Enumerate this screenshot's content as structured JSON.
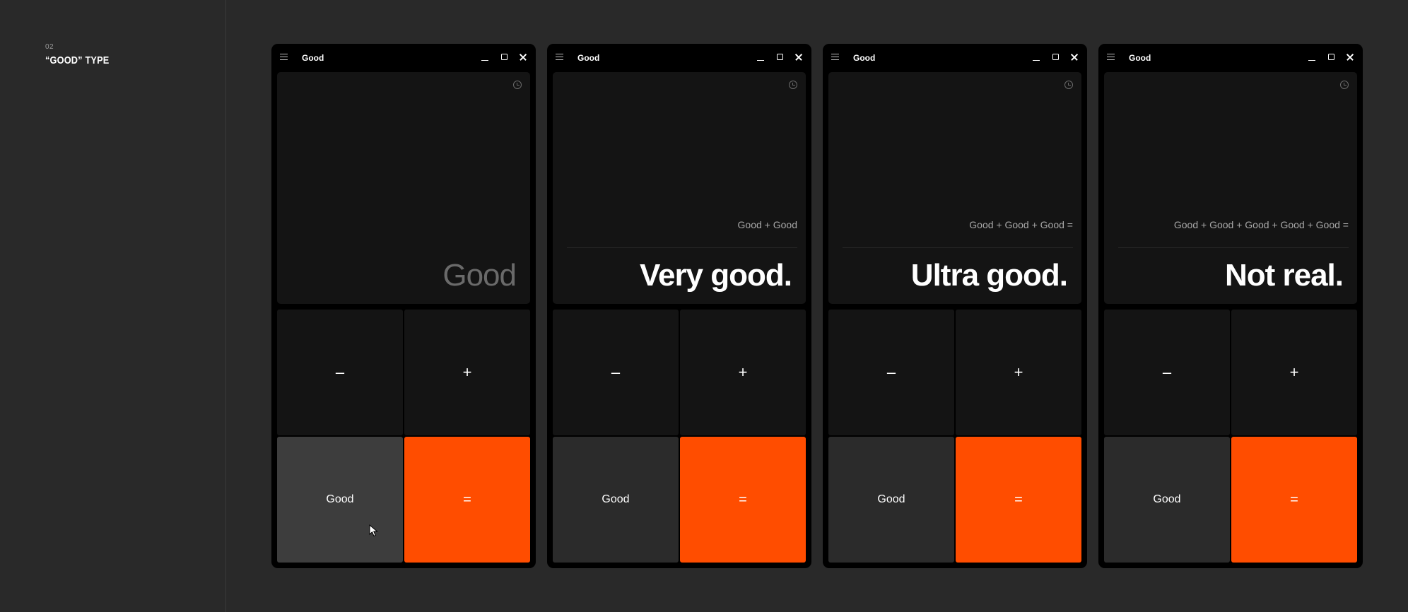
{
  "section": {
    "number": "02",
    "title": "“GOOD” TYPE"
  },
  "windows": [
    {
      "title": "Good",
      "expression": "",
      "result": "Good",
      "keys": {
        "minus": "–",
        "plus": "+",
        "good": "Good",
        "equals": "="
      }
    },
    {
      "title": "Good",
      "expression": "Good + Good",
      "result": "Very good.",
      "keys": {
        "minus": "–",
        "plus": "+",
        "good": "Good",
        "equals": "="
      }
    },
    {
      "title": "Good",
      "expression": "Good + Good + Good =",
      "result": "Ultra good.",
      "keys": {
        "minus": "–",
        "plus": "+",
        "good": "Good",
        "equals": "="
      }
    },
    {
      "title": "Good",
      "expression": "Good + Good + Good + Good + Good =",
      "result": "Not real.",
      "keys": {
        "minus": "–",
        "plus": "+",
        "good": "Good",
        "equals": "="
      }
    }
  ],
  "icons": {
    "menu": "hamburger-icon",
    "minimize": "minimize-icon",
    "maximize": "maximize-icon",
    "close": "close-icon",
    "history": "history-icon",
    "cursor": "mouse-cursor-icon"
  },
  "colors": {
    "background": "#292929",
    "window": "#000000",
    "panel": "#141414",
    "good_key": "#2b2b2b",
    "accent": "#ff4d00"
  }
}
